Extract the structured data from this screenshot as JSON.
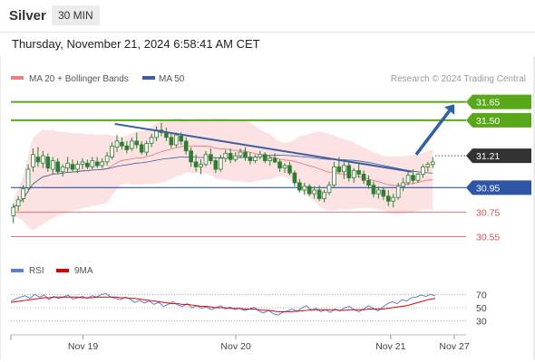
{
  "header": {
    "instrument": "Silver",
    "timeframe": "30 MIN",
    "timestamp": "Thursday, November 21, 2024 6:58:41 AM CET"
  },
  "colors": {
    "candle": "#2e7d32",
    "bollinger_fill": "#fbd8d8",
    "ma20": "#e57373",
    "ma50": "#3b5fa0",
    "resistance": "#58a81a",
    "support_blue": "#2f55a4",
    "support_red": "#e57373",
    "current": "#333333",
    "trendline": "#3b5fa0",
    "arrow": "#2f5fa8",
    "rsi": "#5b7fd4",
    "rsi_ma": "#e00000"
  },
  "chart_data": [
    {
      "type": "candlestick",
      "title": "Silver",
      "legend": [
        {
          "label": "MA 20 + Bollinger Bands",
          "color": "#f08080"
        },
        {
          "label": "MA 50",
          "color": "#3b5fa0"
        }
      ],
      "legend_position": "top-left",
      "watermark": "Research © 2024 Trading Central",
      "x_labels": [
        "Nov 19",
        "Nov 20",
        "Nov 21",
        "Nov 27"
      ],
      "ylim": [
        30.45,
        31.78
      ],
      "levels": [
        {
          "value": 31.65,
          "label": "31.65",
          "kind": "resistance"
        },
        {
          "value": 31.5,
          "label": "31.50",
          "kind": "resistance"
        },
        {
          "value": 31.21,
          "label": "31.21",
          "kind": "current"
        },
        {
          "value": 30.95,
          "label": "30.95",
          "kind": "support_blue"
        },
        {
          "value": 30.75,
          "label": "30.75",
          "kind": "support_red"
        },
        {
          "value": 30.55,
          "label": "30.55",
          "kind": "support_red"
        }
      ],
      "trendline": {
        "from": [
          0.245,
          31.47
        ],
        "to": [
          0.945,
          31.08
        ]
      },
      "projection_arrow": {
        "from": [
          0.955,
          31.22
        ],
        "to": [
          1.045,
          31.63
        ]
      },
      "candles": [
        [
          30.72,
          30.82,
          30.66,
          30.79
        ],
        [
          30.8,
          30.88,
          30.76,
          30.85
        ],
        [
          30.86,
          30.97,
          30.83,
          30.94
        ],
        [
          30.95,
          31.14,
          30.93,
          31.1
        ],
        [
          31.12,
          31.27,
          31.08,
          31.22
        ],
        [
          31.2,
          31.28,
          31.12,
          31.16
        ],
        [
          31.15,
          31.25,
          31.11,
          31.21
        ],
        [
          31.2,
          31.23,
          31.08,
          31.11
        ],
        [
          31.1,
          31.2,
          31.06,
          31.17
        ],
        [
          31.16,
          31.19,
          31.06,
          31.08
        ],
        [
          31.08,
          31.14,
          31.04,
          31.12
        ],
        [
          31.11,
          31.2,
          31.08,
          31.15
        ],
        [
          31.14,
          31.18,
          31.08,
          31.1
        ],
        [
          31.1,
          31.17,
          31.07,
          31.14
        ],
        [
          31.14,
          31.19,
          31.1,
          31.16
        ],
        [
          31.15,
          31.18,
          31.1,
          31.12
        ],
        [
          31.12,
          31.2,
          31.1,
          31.17
        ],
        [
          31.16,
          31.2,
          31.11,
          31.13
        ],
        [
          31.13,
          31.19,
          31.11,
          31.16
        ],
        [
          31.16,
          31.24,
          31.13,
          31.21
        ],
        [
          31.2,
          31.32,
          31.18,
          31.29
        ],
        [
          31.28,
          31.38,
          31.24,
          31.33
        ],
        [
          31.32,
          31.36,
          31.26,
          31.29
        ],
        [
          31.29,
          31.33,
          31.23,
          31.26
        ],
        [
          31.27,
          31.36,
          31.25,
          31.33
        ],
        [
          31.33,
          31.4,
          31.27,
          31.3
        ],
        [
          31.3,
          31.33,
          31.22,
          31.24
        ],
        [
          31.24,
          31.33,
          31.21,
          31.31
        ],
        [
          31.31,
          31.39,
          31.28,
          31.36
        ],
        [
          31.36,
          31.45,
          31.33,
          31.42
        ],
        [
          31.42,
          31.48,
          31.37,
          31.4
        ],
        [
          31.4,
          31.44,
          31.33,
          31.36
        ],
        [
          31.36,
          31.39,
          31.27,
          31.3
        ],
        [
          31.3,
          31.4,
          31.28,
          31.38
        ],
        [
          31.37,
          31.4,
          31.3,
          31.33
        ],
        [
          31.33,
          31.36,
          31.22,
          31.25
        ],
        [
          31.25,
          31.28,
          31.12,
          31.16
        ],
        [
          31.16,
          31.22,
          31.08,
          31.12
        ],
        [
          31.12,
          31.18,
          31.06,
          31.14
        ],
        [
          31.14,
          31.25,
          31.12,
          31.22
        ],
        [
          31.22,
          31.27,
          31.14,
          31.17
        ],
        [
          31.17,
          31.2,
          31.07,
          31.1
        ],
        [
          31.1,
          31.22,
          31.08,
          31.19
        ],
        [
          31.19,
          31.26,
          31.16,
          31.23
        ],
        [
          31.23,
          31.27,
          31.15,
          31.18
        ],
        [
          31.18,
          31.24,
          31.16,
          31.21
        ],
        [
          31.21,
          31.27,
          31.19,
          31.24
        ],
        [
          31.24,
          31.28,
          31.17,
          31.2
        ],
        [
          31.2,
          31.24,
          31.14,
          31.17
        ],
        [
          31.17,
          31.22,
          31.15,
          31.2
        ],
        [
          31.2,
          31.25,
          31.18,
          31.22
        ],
        [
          31.22,
          31.24,
          31.15,
          31.17
        ],
        [
          31.17,
          31.21,
          31.13,
          31.19
        ],
        [
          31.19,
          31.23,
          31.15,
          31.16
        ],
        [
          31.16,
          31.18,
          31.08,
          31.11
        ],
        [
          31.11,
          31.15,
          31.07,
          31.13
        ],
        [
          31.13,
          31.16,
          31.05,
          31.07
        ],
        [
          31.07,
          31.09,
          30.96,
          30.99
        ],
        [
          30.99,
          31.02,
          30.91,
          30.93
        ],
        [
          30.93,
          30.99,
          30.89,
          30.96
        ],
        [
          30.96,
          30.98,
          30.88,
          30.9
        ],
        [
          30.9,
          30.96,
          30.86,
          30.93
        ],
        [
          30.93,
          30.97,
          30.84,
          30.86
        ],
        [
          30.86,
          30.93,
          30.83,
          30.91
        ],
        [
          30.91,
          31.0,
          30.89,
          30.97
        ],
        [
          30.97,
          31.16,
          30.95,
          31.12
        ],
        [
          31.12,
          31.2,
          31.06,
          31.08
        ],
        [
          31.08,
          31.16,
          31.02,
          31.13
        ],
        [
          31.13,
          31.17,
          31.0,
          31.03
        ],
        [
          31.03,
          31.11,
          30.99,
          31.09
        ],
        [
          31.09,
          31.14,
          31.03,
          31.06
        ],
        [
          31.06,
          31.09,
          30.98,
          31.01
        ],
        [
          31.01,
          31.05,
          30.94,
          30.97
        ],
        [
          30.97,
          31.0,
          30.87,
          30.9
        ],
        [
          30.9,
          30.96,
          30.86,
          30.93
        ],
        [
          30.93,
          30.95,
          30.85,
          30.88
        ],
        [
          30.88,
          30.93,
          30.8,
          30.84
        ],
        [
          30.84,
          30.9,
          30.79,
          30.87
        ],
        [
          30.87,
          30.99,
          30.85,
          30.96
        ],
        [
          30.96,
          31.03,
          30.92,
          30.99
        ],
        [
          30.99,
          31.08,
          30.97,
          31.05
        ],
        [
          31.05,
          31.1,
          30.98,
          31.01
        ],
        [
          31.01,
          31.07,
          30.99,
          31.06
        ],
        [
          31.06,
          31.14,
          31.03,
          31.12
        ],
        [
          31.12,
          31.16,
          31.08,
          31.14
        ],
        [
          31.14,
          31.2,
          31.11,
          31.16
        ]
      ]
    },
    {
      "type": "line",
      "title": "RSI",
      "legend": [
        {
          "label": "RSI",
          "color": "#5b7fd4"
        },
        {
          "label": "9MA",
          "color": "#e00000"
        }
      ],
      "ylim": [
        20,
        80
      ],
      "yticks": [
        70,
        50,
        30
      ],
      "rsi": [
        60,
        63,
        66,
        68,
        64,
        70,
        66,
        69,
        62,
        67,
        64,
        66,
        69,
        63,
        65,
        67,
        64,
        68,
        66,
        70,
        71,
        66,
        64,
        62,
        66,
        63,
        58,
        61,
        57,
        60,
        55,
        58,
        52,
        55,
        59,
        54,
        52,
        56,
        50,
        53,
        49,
        51,
        47,
        50,
        53,
        48,
        51,
        47,
        49,
        46,
        48,
        51,
        45,
        42,
        46,
        41,
        39,
        43,
        45,
        48,
        44,
        50,
        53,
        46,
        49,
        44,
        47,
        43,
        48,
        45,
        50,
        52,
        47,
        44,
        48,
        53,
        49,
        45,
        51,
        56,
        59,
        56,
        62,
        60,
        65,
        66,
        69,
        67,
        70,
        68
      ],
      "ma9": [
        58,
        59,
        60,
        61,
        62,
        63,
        64,
        65,
        65,
        66,
        66,
        66,
        66,
        66,
        66,
        65,
        65,
        65,
        66,
        66,
        66,
        66,
        66,
        65,
        65,
        64,
        64,
        63,
        62,
        61,
        60,
        59,
        58,
        57,
        56,
        56,
        55,
        55,
        54,
        53,
        52,
        52,
        51,
        50,
        50,
        50,
        49,
        49,
        49,
        48,
        48,
        48,
        47,
        46,
        46,
        45,
        44,
        44,
        44,
        44,
        45,
        45,
        46,
        47,
        47,
        47,
        47,
        47,
        47,
        46,
        46,
        47,
        47,
        47,
        47,
        48,
        48,
        48,
        48,
        49,
        50,
        51,
        52,
        53,
        55,
        57,
        59,
        61,
        63,
        64
      ]
    }
  ]
}
